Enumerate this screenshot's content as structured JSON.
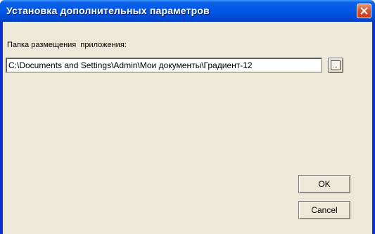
{
  "window": {
    "title": "Установка дополнительных параметров"
  },
  "path": {
    "label": "Папка размещения  приложения:",
    "value": "C:\\Documents and Settings\\Admin\\Мои документы\\Градиент-12"
  },
  "browse": {
    "label": "..."
  },
  "buttons": {
    "ok": "OK",
    "cancel": "Cancel"
  },
  "colors": {
    "titlebar": "#0058e6",
    "client": "#ece9d8",
    "close": "#d9542e"
  }
}
